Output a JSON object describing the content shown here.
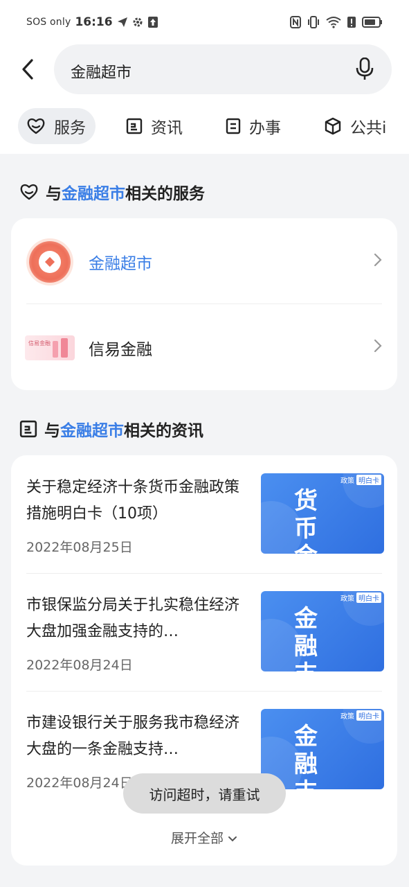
{
  "status_bar": {
    "carrier": "SOS only",
    "time": "16:16"
  },
  "search": {
    "query": "金融超市"
  },
  "tabs": [
    {
      "label": "服务",
      "icon": "heart-icon",
      "active": true
    },
    {
      "label": "资讯",
      "icon": "news-icon",
      "active": false
    },
    {
      "label": "办事",
      "icon": "document-icon",
      "active": false
    },
    {
      "label": "公共i",
      "icon": "cube-icon",
      "active": false
    }
  ],
  "services_section": {
    "prefix": "与",
    "keyword": "金融超市",
    "suffix": "相关的服务",
    "items": [
      {
        "name": "金融超市",
        "color": "#3a7ee6"
      },
      {
        "name": "信易金融",
        "logo_text": "信易金融",
        "color": "#222222"
      }
    ]
  },
  "news_section": {
    "prefix": "与",
    "keyword": "金融超市",
    "suffix": "相关的资讯",
    "items": [
      {
        "title": "关于稳定经济十条货币金融政策措施明白卡（10项）",
        "date": "2022年08月25日",
        "thumb_text": "货币金融",
        "tag_a": "政策",
        "tag_b": "明白卡"
      },
      {
        "title": "市银保监分局关于扎实稳住经济大盘加强金融支持的…",
        "date": "2022年08月24日",
        "thumb_text": "金融支持",
        "tag_a": "政策",
        "tag_b": "明白卡"
      },
      {
        "title": "市建设银行关于服务我市稳经济大盘的一条金融支持…",
        "date": "2022年08月24日",
        "thumb_text": "金融支持",
        "tag_a": "政策",
        "tag_b": "明白卡"
      }
    ],
    "expand_label": "展开全部"
  },
  "toast": "访问超时，请重试",
  "colors": {
    "accent": "#3a7ee6",
    "background": "#f3f4f6",
    "thumb_blue": "#2f6fe0"
  }
}
